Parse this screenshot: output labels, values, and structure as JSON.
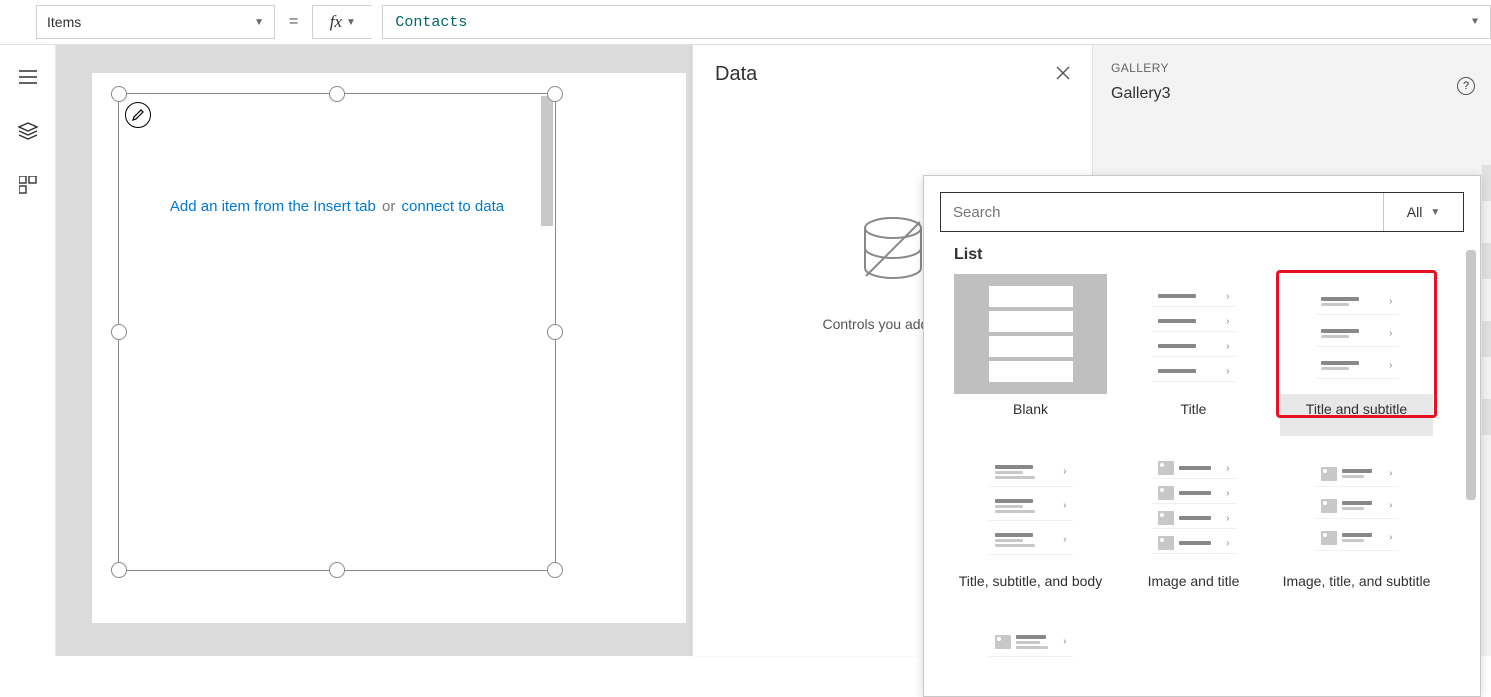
{
  "formula_bar": {
    "property": "Items",
    "equals": "=",
    "fx": "fx",
    "expression": "Contacts"
  },
  "canvas": {
    "hint_left": "Add an item from the Insert tab",
    "hint_or": "or",
    "hint_right": "connect to data"
  },
  "data_panel": {
    "title": "Data",
    "empty_text": "Controls you add will s"
  },
  "props_panel": {
    "category": "GALLERY",
    "name": "Gallery3"
  },
  "layout_popup": {
    "search_placeholder": "Search",
    "filter_label": "All",
    "section": "List",
    "tiles": [
      {
        "label": "Blank"
      },
      {
        "label": "Title"
      },
      {
        "label": "Title and subtitle"
      },
      {
        "label": "Title, subtitle, and body"
      },
      {
        "label": "Image and title"
      },
      {
        "label": "Image, title, and subtitle"
      }
    ]
  }
}
